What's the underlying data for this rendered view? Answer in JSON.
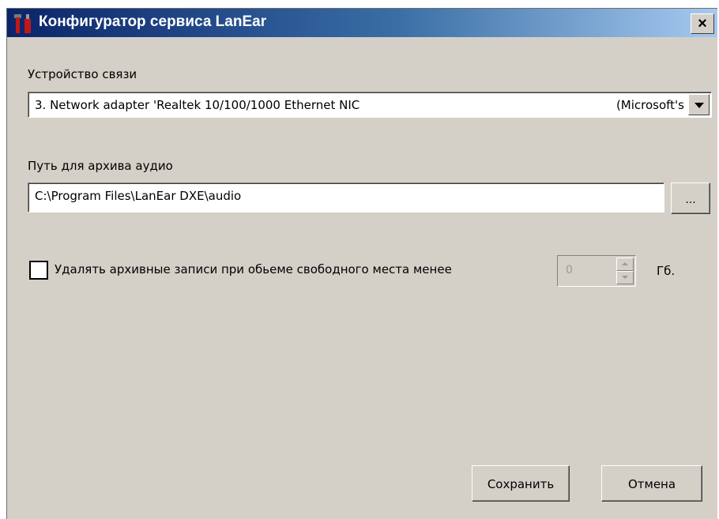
{
  "window": {
    "title": "Конфигуратор сервиса LanEar",
    "close_label": "×"
  },
  "device": {
    "label": "Устройство связи",
    "selected_value": "3. Network adapter 'Realtek 10/100/1000 Ethernet NIC",
    "selected_suffix": "(Microsoft's"
  },
  "archive": {
    "label": "Путь для архива аудио",
    "path_value": "C:\\Program Files\\LanEar DXE\\audio",
    "browse_label": "..."
  },
  "cleanup": {
    "checkbox_label": "Удалять архивные записи при обьеме свободного места менее",
    "checked": false,
    "threshold_value": "0",
    "unit": "Гб."
  },
  "buttons": {
    "save_label": "Сохранить",
    "cancel_label": "Отмена"
  }
}
